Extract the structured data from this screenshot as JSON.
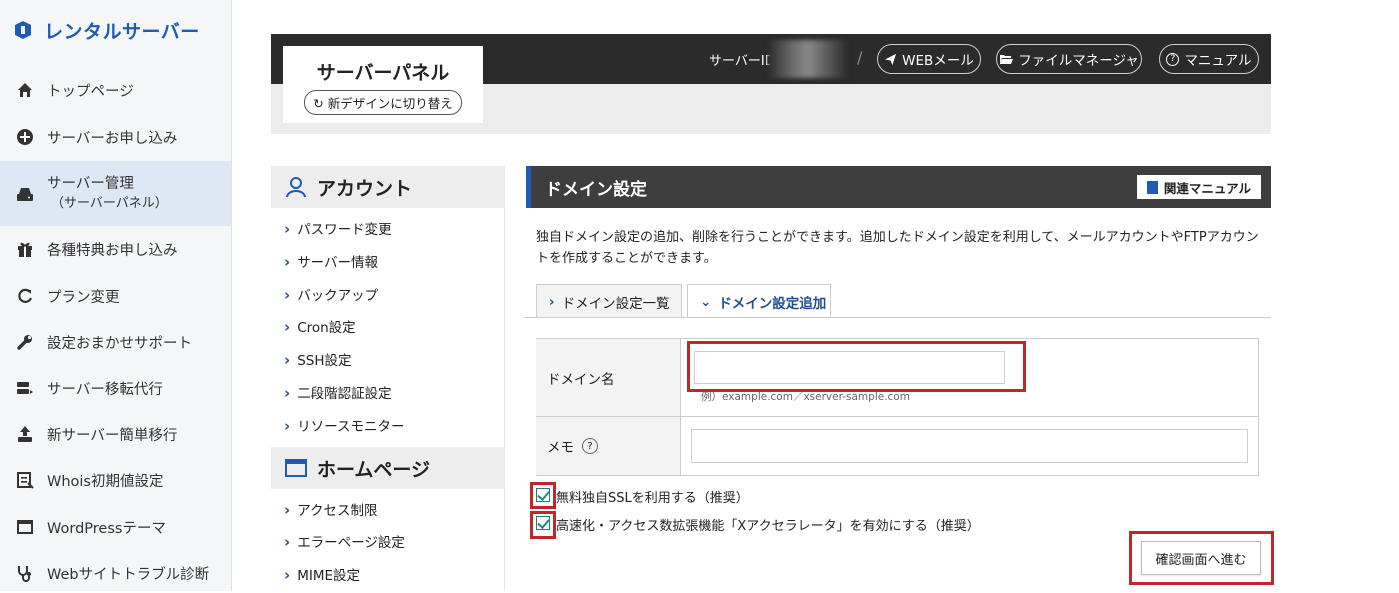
{
  "brand": {
    "name": "レンタルサーバー"
  },
  "sidebar": {
    "items": [
      {
        "label": "トップページ",
        "icon": "home-icon"
      },
      {
        "label": "サーバーお申し込み",
        "icon": "plus-circle-icon"
      },
      {
        "label": "サーバー管理",
        "sub": "（サーバーパネル）",
        "icon": "server-icon",
        "active": true
      },
      {
        "label": "各種特典お申し込み",
        "icon": "gift-icon"
      },
      {
        "label": "プラン変更",
        "icon": "refresh-icon"
      },
      {
        "label": "設定おまかせサポート",
        "icon": "wrench-icon"
      },
      {
        "label": "サーバー移転代行",
        "icon": "server-move-icon"
      },
      {
        "label": "新サーバー簡単移行",
        "icon": "upload-icon"
      },
      {
        "label": "Whois初期値設定",
        "icon": "document-icon"
      },
      {
        "label": "WordPressテーマ",
        "icon": "window-icon"
      },
      {
        "label": "Webサイトトラブル診断",
        "icon": "stethoscope-icon"
      }
    ]
  },
  "panel": {
    "title": "サーバーパネル",
    "redesign_label": "新デザインに切り替え",
    "server_id_label": "サーバーID",
    "separator": "/",
    "webmail_label": "WEBメール",
    "file_manager_label": "ファイルマネージャ",
    "manual_label": "マニュアル"
  },
  "account_menu": {
    "heading": "アカウント",
    "links": [
      "パスワード変更",
      "サーバー情報",
      "バックアップ",
      "Cron設定",
      "SSH設定",
      "二段階認証設定",
      "リソースモニター"
    ]
  },
  "homepage_menu": {
    "heading": "ホームページ",
    "links": [
      "アクセス制限",
      "エラーページ設定",
      "MIME設定"
    ]
  },
  "content": {
    "title": "ドメイン設定",
    "manual_button": "関連マニュアル",
    "description": "独自ドメイン設定の追加、削除を行うことができます。追加したドメイン設定を利用して、メールアカウントやFTPアカウントを作成することができます。",
    "tabs": [
      {
        "label": "ドメイン設定一覧",
        "active": false
      },
      {
        "label": "ドメイン設定追加",
        "active": true
      }
    ],
    "form": {
      "domain_label": "ドメイン名",
      "domain_value": "",
      "domain_hint": "例）example.com／xserver-sample.com",
      "memo_label": "メモ",
      "memo_help": "?",
      "memo_value": ""
    },
    "options": [
      {
        "label": "無料独自SSLを利用する（推奨）",
        "checked": true
      },
      {
        "label": "高速化・アクセス数拡張機能「Xアクセラレータ」を有効にする（推奨）",
        "checked": true
      }
    ],
    "confirm_button": "確認画面へ進む"
  },
  "colors": {
    "brand": "#1d5bb5",
    "highlight": "#c0272d",
    "header_dark": "#2b2b2b"
  }
}
